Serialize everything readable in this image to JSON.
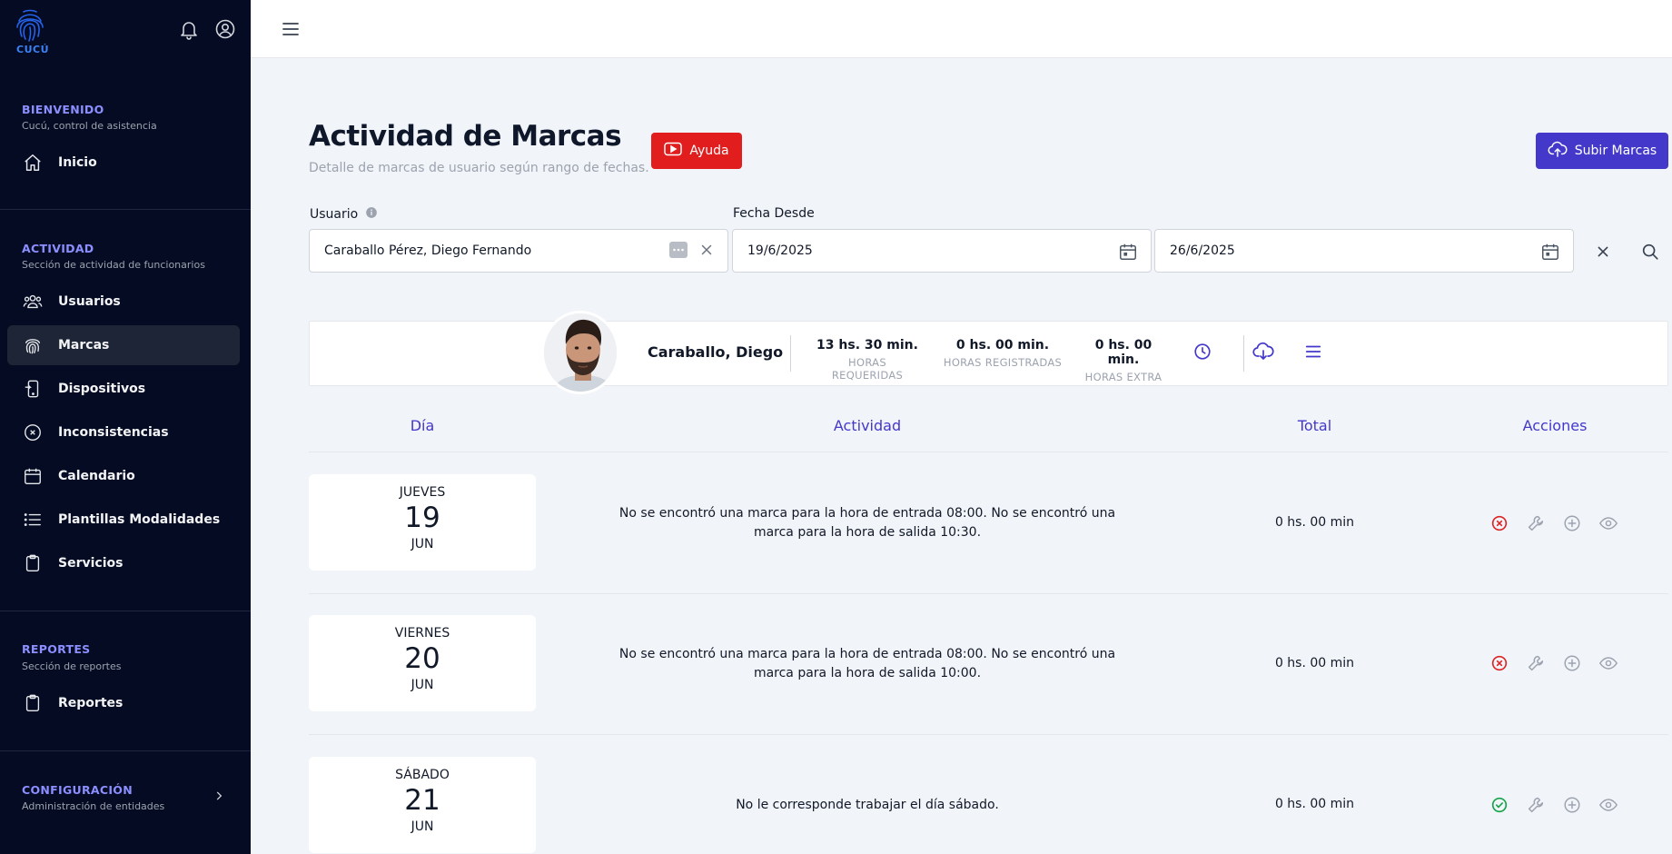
{
  "sidebar": {
    "logo_text": "CUCÚ",
    "sections": [
      {
        "title": "BIENVENIDO",
        "subtitle": "Cucú, control de asistencia",
        "items": [
          {
            "label": "Inicio",
            "icon": "home-icon"
          }
        ]
      },
      {
        "title": "ACTIVIDAD",
        "subtitle": "Sección de actividad de funcionarios",
        "items": [
          {
            "label": "Usuarios",
            "icon": "users-icon"
          },
          {
            "label": "Marcas",
            "icon": "fingerprint-icon",
            "active": true
          },
          {
            "label": "Dispositivos",
            "icon": "device-icon"
          },
          {
            "label": "Inconsistencias",
            "icon": "x-circle-icon"
          },
          {
            "label": "Calendario",
            "icon": "calendar-icon"
          },
          {
            "label": "Plantillas Modalidades",
            "icon": "list-icon"
          },
          {
            "label": "Servicios",
            "icon": "clipboard-icon"
          }
        ]
      },
      {
        "title": "REPORTES",
        "subtitle": "Sección de reportes",
        "items": [
          {
            "label": "Reportes",
            "icon": "clipboard-icon"
          }
        ]
      },
      {
        "title": "CONFIGURACIÓN",
        "subtitle": "Administración de entidades",
        "items": []
      }
    ]
  },
  "header": {
    "title": "Actividad de Marcas",
    "subtitle": "Detalle de marcas de usuario según rango de fechas.",
    "help_label": "Ayuda",
    "upload_label": "Subir Marcas"
  },
  "filters": {
    "user_label": "Usuario",
    "user_value": "Caraballo Pérez, Diego Fernando",
    "date_from_label": "Fecha Desde",
    "date_from_value": "19/6/2025",
    "date_to_value": "26/6/2025"
  },
  "summary": {
    "name": "Caraballo, Diego",
    "stats": [
      {
        "value": "13 hs. 30 min.",
        "label": "HORAS REQUERIDAS"
      },
      {
        "value": "0 hs. 00 min.",
        "label": "HORAS REGISTRADAS"
      },
      {
        "value": "0 hs. 00 min.",
        "label": "HORAS EXTRA"
      }
    ]
  },
  "table": {
    "headers": {
      "day": "Día",
      "activity": "Actividad",
      "total": "Total",
      "actions": "Acciones"
    },
    "rows": [
      {
        "weekday": "JUEVES",
        "day": "19",
        "month": "JUN",
        "activity": "No se encontró una marca para la hora de entrada 08:00. No se encontró una marca para la hora de salida 10:30.",
        "total": "0 hs. 00 min",
        "status": "error",
        "status_color": "#dc2626"
      },
      {
        "weekday": "VIERNES",
        "day": "20",
        "month": "JUN",
        "activity": "No se encontró una marca para la hora de entrada 08:00. No se encontró una marca para la hora de salida 10:00.",
        "total": "0 hs. 00 min",
        "status": "error",
        "status_color": "#dc2626"
      },
      {
        "weekday": "SÁBADO",
        "day": "21",
        "month": "JUN",
        "activity": "No le corresponde trabajar el día sábado.",
        "total": "0 hs. 00 min",
        "status": "ok",
        "status_color": "#16a34a"
      }
    ]
  },
  "colors": {
    "sidebar_bg": "#050b22",
    "accent": "#4338ca",
    "help_red": "#e11d1d"
  }
}
